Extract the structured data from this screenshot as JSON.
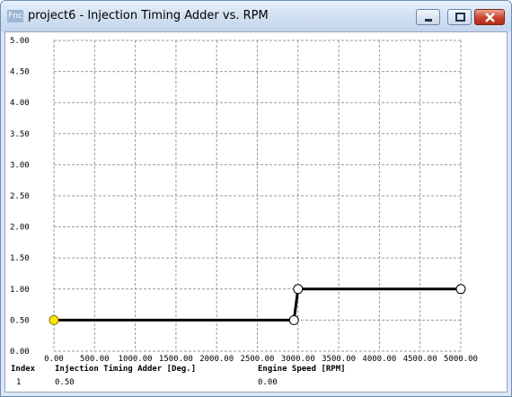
{
  "window": {
    "title": "project6 - Injection Timing Adder vs. RPM",
    "app_icon_text": "Fnc"
  },
  "chart_data": {
    "type": "line",
    "x": [
      0,
      2950,
      3000,
      5000
    ],
    "y": [
      0.5,
      0.5,
      1.0,
      1.0
    ],
    "xlim": [
      0,
      5000
    ],
    "ylim": [
      0,
      5
    ],
    "x_ticks": [
      "0.00",
      "500.00",
      "1000.00",
      "1500.00",
      "2000.00",
      "2500.00",
      "3000.00",
      "3500.00",
      "4000.00",
      "4500.00",
      "5000.00"
    ],
    "y_ticks": [
      "0.00",
      "0.50",
      "1.00",
      "1.50",
      "2.00",
      "2.50",
      "3.00",
      "3.50",
      "4.00",
      "4.50",
      "5.00"
    ],
    "grid": true,
    "selected_point_index": 0
  },
  "info_table": {
    "headers": {
      "index": "Index",
      "y_name": "Injection Timing Adder [Deg.]",
      "x_name": "Engine Speed [RPM]"
    },
    "row": {
      "index": "1",
      "y_value": "0.50",
      "x_value": "0.00"
    }
  }
}
